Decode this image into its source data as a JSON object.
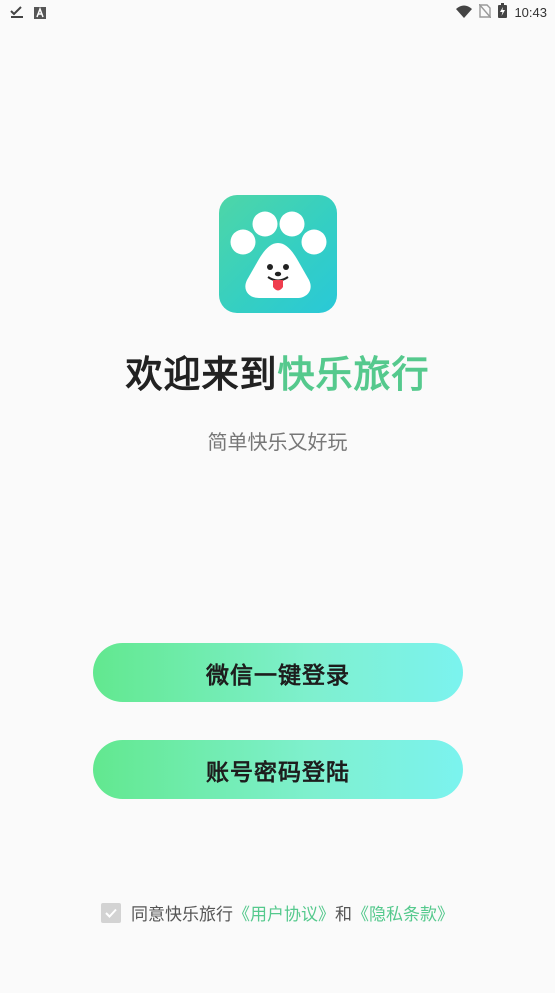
{
  "status_bar": {
    "time": "10:43",
    "left_icons": [
      "download-done-icon",
      "text-a-icon"
    ],
    "right_icons": [
      "wifi-icon",
      "no-sim-icon",
      "battery-icon"
    ]
  },
  "logo": {
    "icon": "paw-dog-icon",
    "colors": [
      "#4ed6a7",
      "#29c8d8"
    ]
  },
  "welcome": {
    "prefix": "欢迎来到",
    "app_name": "快乐旅行",
    "accent_color": "#55c98d"
  },
  "tagline": "简单快乐又好玩",
  "buttons": {
    "wechat_login": "微信一键登录",
    "account_login": "账号密码登陆"
  },
  "agreement": {
    "checked": true,
    "prefix": "同意快乐旅行",
    "user_agreement": "《用户协议》",
    "conjunction": "和",
    "privacy_policy": "《隐私条款》"
  }
}
